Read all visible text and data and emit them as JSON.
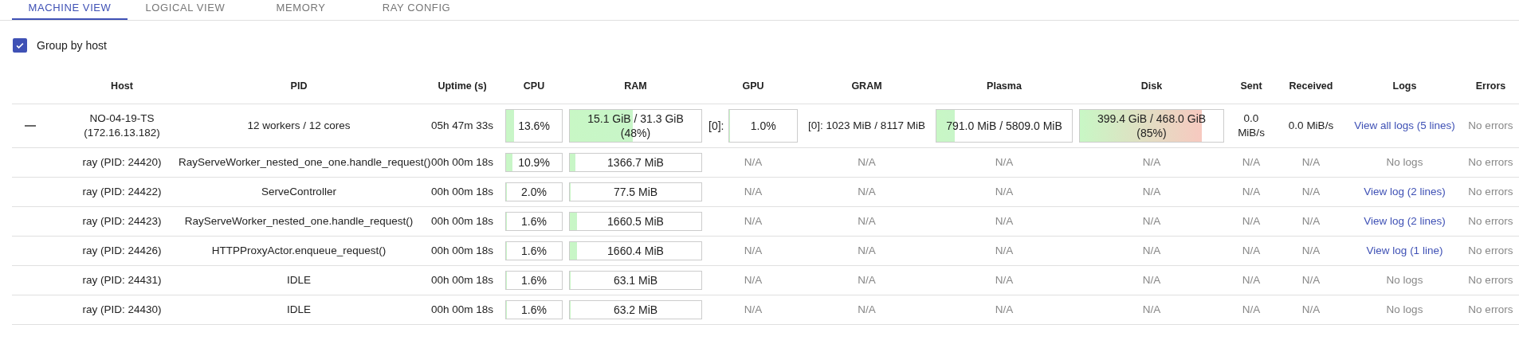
{
  "tabs": [
    {
      "label": "MACHINE VIEW",
      "selected": true
    },
    {
      "label": "LOGICAL VIEW",
      "selected": false
    },
    {
      "label": "MEMORY",
      "selected": false
    },
    {
      "label": "RAY CONFIG",
      "selected": false
    }
  ],
  "group_by_host": {
    "label": "Group by host",
    "checked": true
  },
  "table": {
    "columns": [
      "",
      "Host",
      "PID",
      "Uptime (s)",
      "CPU",
      "RAM",
      "GPU",
      "GRAM",
      "Plasma",
      "Disk",
      "Sent",
      "Received",
      "Logs",
      "Errors"
    ],
    "rows": [
      {
        "cells": [
          {
            "kind": "toggle",
            "expanded": true
          },
          {
            "kind": "text",
            "text": "NO-04-19-TS (172.16.13.182)"
          },
          {
            "kind": "text",
            "text": "12 workers / 12 cores"
          },
          {
            "kind": "text",
            "text": "05h 47m 33s"
          },
          {
            "kind": "meter",
            "text": "13.6%",
            "level": 0.136
          },
          {
            "kind": "meter",
            "text": "15.1 GiB / 31.3 GiB (48%)",
            "level": 0.48
          },
          {
            "kind": "meter",
            "label": "[0]:",
            "text": "1.0%",
            "level": 0.01
          },
          {
            "kind": "text",
            "text": "[0]: 1023 MiB / 8117 MiB"
          },
          {
            "kind": "meter",
            "text": "791.0 MiB / 5809.0 MiB",
            "level": 0.136
          },
          {
            "kind": "meter",
            "text": "399.4 GiB / 468.0 GiB (85%)",
            "level": 0.85
          },
          {
            "kind": "text",
            "text": "0.0 MiB/s"
          },
          {
            "kind": "text",
            "text": "0.0 MiB/s"
          },
          {
            "kind": "link",
            "text": "View all logs (5 lines)"
          },
          {
            "kind": "muted",
            "text": "No errors"
          }
        ]
      },
      {
        "cells": [
          {
            "kind": "blank"
          },
          {
            "kind": "text",
            "text": "ray (PID: 24420)"
          },
          {
            "kind": "text",
            "text": "RayServeWorker_nested_one_one.handle_request()"
          },
          {
            "kind": "text",
            "text": "00h 00m 18s"
          },
          {
            "kind": "meter",
            "text": "10.9%",
            "level": 0.109
          },
          {
            "kind": "meter",
            "text": "1366.7 MiB",
            "level": 0.043
          },
          {
            "kind": "muted",
            "text": "N/A"
          },
          {
            "kind": "muted",
            "text": "N/A"
          },
          {
            "kind": "muted",
            "text": "N/A"
          },
          {
            "kind": "muted",
            "text": "N/A"
          },
          {
            "kind": "muted",
            "text": "N/A"
          },
          {
            "kind": "muted",
            "text": "N/A"
          },
          {
            "kind": "muted",
            "text": "No logs"
          },
          {
            "kind": "muted",
            "text": "No errors"
          }
        ]
      },
      {
        "cells": [
          {
            "kind": "blank"
          },
          {
            "kind": "text",
            "text": "ray (PID: 24422)"
          },
          {
            "kind": "text",
            "text": "ServeController"
          },
          {
            "kind": "text",
            "text": "00h 00m 18s"
          },
          {
            "kind": "meter",
            "text": "2.0%",
            "level": 0.02
          },
          {
            "kind": "meter",
            "text": "77.5 MiB",
            "level": 0.002
          },
          {
            "kind": "muted",
            "text": "N/A"
          },
          {
            "kind": "muted",
            "text": "N/A"
          },
          {
            "kind": "muted",
            "text": "N/A"
          },
          {
            "kind": "muted",
            "text": "N/A"
          },
          {
            "kind": "muted",
            "text": "N/A"
          },
          {
            "kind": "muted",
            "text": "N/A"
          },
          {
            "kind": "link",
            "text": "View log (2 lines)"
          },
          {
            "kind": "muted",
            "text": "No errors"
          }
        ]
      },
      {
        "cells": [
          {
            "kind": "blank"
          },
          {
            "kind": "text",
            "text": "ray (PID: 24423)"
          },
          {
            "kind": "text",
            "text": "RayServeWorker_nested_one.handle_request()"
          },
          {
            "kind": "text",
            "text": "00h 00m 18s"
          },
          {
            "kind": "meter",
            "text": "1.6%",
            "level": 0.016
          },
          {
            "kind": "meter",
            "text": "1660.5 MiB",
            "level": 0.052
          },
          {
            "kind": "muted",
            "text": "N/A"
          },
          {
            "kind": "muted",
            "text": "N/A"
          },
          {
            "kind": "muted",
            "text": "N/A"
          },
          {
            "kind": "muted",
            "text": "N/A"
          },
          {
            "kind": "muted",
            "text": "N/A"
          },
          {
            "kind": "muted",
            "text": "N/A"
          },
          {
            "kind": "link",
            "text": "View log (2 lines)"
          },
          {
            "kind": "muted",
            "text": "No errors"
          }
        ]
      },
      {
        "cells": [
          {
            "kind": "blank"
          },
          {
            "kind": "text",
            "text": "ray (PID: 24426)"
          },
          {
            "kind": "text",
            "text": "HTTPProxyActor.enqueue_request()"
          },
          {
            "kind": "text",
            "text": "00h 00m 18s"
          },
          {
            "kind": "meter",
            "text": "1.6%",
            "level": 0.016
          },
          {
            "kind": "meter",
            "text": "1660.4 MiB",
            "level": 0.052
          },
          {
            "kind": "muted",
            "text": "N/A"
          },
          {
            "kind": "muted",
            "text": "N/A"
          },
          {
            "kind": "muted",
            "text": "N/A"
          },
          {
            "kind": "muted",
            "text": "N/A"
          },
          {
            "kind": "muted",
            "text": "N/A"
          },
          {
            "kind": "muted",
            "text": "N/A"
          },
          {
            "kind": "link",
            "text": "View log (1 line)"
          },
          {
            "kind": "muted",
            "text": "No errors"
          }
        ]
      },
      {
        "cells": [
          {
            "kind": "blank"
          },
          {
            "kind": "text",
            "text": "ray (PID: 24431)"
          },
          {
            "kind": "text",
            "text": "IDLE"
          },
          {
            "kind": "text",
            "text": "00h 00m 18s"
          },
          {
            "kind": "meter",
            "text": "1.6%",
            "level": 0.016
          },
          {
            "kind": "meter",
            "text": "63.1 MiB",
            "level": 0.002
          },
          {
            "kind": "muted",
            "text": "N/A"
          },
          {
            "kind": "muted",
            "text": "N/A"
          },
          {
            "kind": "muted",
            "text": "N/A"
          },
          {
            "kind": "muted",
            "text": "N/A"
          },
          {
            "kind": "muted",
            "text": "N/A"
          },
          {
            "kind": "muted",
            "text": "N/A"
          },
          {
            "kind": "muted",
            "text": "No logs"
          },
          {
            "kind": "muted",
            "text": "No errors"
          }
        ]
      },
      {
        "cells": [
          {
            "kind": "blank"
          },
          {
            "kind": "text",
            "text": "ray (PID: 24430)"
          },
          {
            "kind": "text",
            "text": "IDLE"
          },
          {
            "kind": "text",
            "text": "00h 00m 18s"
          },
          {
            "kind": "meter",
            "text": "1.6%",
            "level": 0.016
          },
          {
            "kind": "meter",
            "text": "63.2 MiB",
            "level": 0.002
          },
          {
            "kind": "muted",
            "text": "N/A"
          },
          {
            "kind": "muted",
            "text": "N/A"
          },
          {
            "kind": "muted",
            "text": "N/A"
          },
          {
            "kind": "muted",
            "text": "N/A"
          },
          {
            "kind": "muted",
            "text": "N/A"
          },
          {
            "kind": "muted",
            "text": "N/A"
          },
          {
            "kind": "muted",
            "text": "No logs"
          },
          {
            "kind": "muted",
            "text": "No errors"
          }
        ]
      }
    ]
  }
}
